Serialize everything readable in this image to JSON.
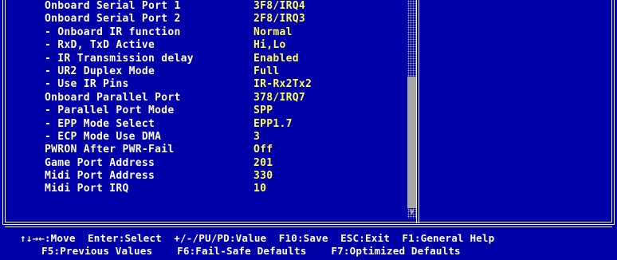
{
  "settings": [
    {
      "label": "Onboard Serial Port 1",
      "value": "3F8/IRQ4"
    },
    {
      "label": "Onboard Serial Port 2",
      "value": "2F8/IRQ3"
    },
    {
      "label": "- Onboard IR function",
      "value": "Normal"
    },
    {
      "label": "- RxD, TxD Active",
      "value": "Hi,Lo"
    },
    {
      "label": "- IR Transmission delay",
      "value": "Enabled"
    },
    {
      "label": "- UR2 Duplex Mode",
      "value": "Full"
    },
    {
      "label": "- Use IR Pins",
      "value": "IR-Rx2Tx2"
    },
    {
      "label": "Onboard Parallel Port",
      "value": "378/IRQ7"
    },
    {
      "label": "- Parallel Port Mode",
      "value": "SPP"
    },
    {
      "label": "- EPP Mode Select",
      "value": "EPP1.7"
    },
    {
      "label": "- ECP Mode Use DMA",
      "value": "3"
    },
    {
      "label": "PWRON After PWR-Fail",
      "value": "Off"
    },
    {
      "label": "Game Port Address",
      "value": "201"
    },
    {
      "label": "Midi Port Address",
      "value": "330"
    },
    {
      "label": "Midi Port IRQ",
      "value": "10"
    }
  ],
  "footer": {
    "line1": "↑↓→←:Move  Enter:Select  +/-/PU/PD:Value  F10:Save  ESC:Exit  F1:General Help",
    "line2": "F5:Previous Values    F6:Fail-Safe Defaults    F7:Optimized Defaults"
  },
  "scrollbar": {
    "down_arrow": "▼"
  },
  "colors": {
    "background": "#0000A8",
    "label": "#FFFFFF",
    "value": "#FFFF54",
    "scrollbar": "#A8A8A8"
  }
}
